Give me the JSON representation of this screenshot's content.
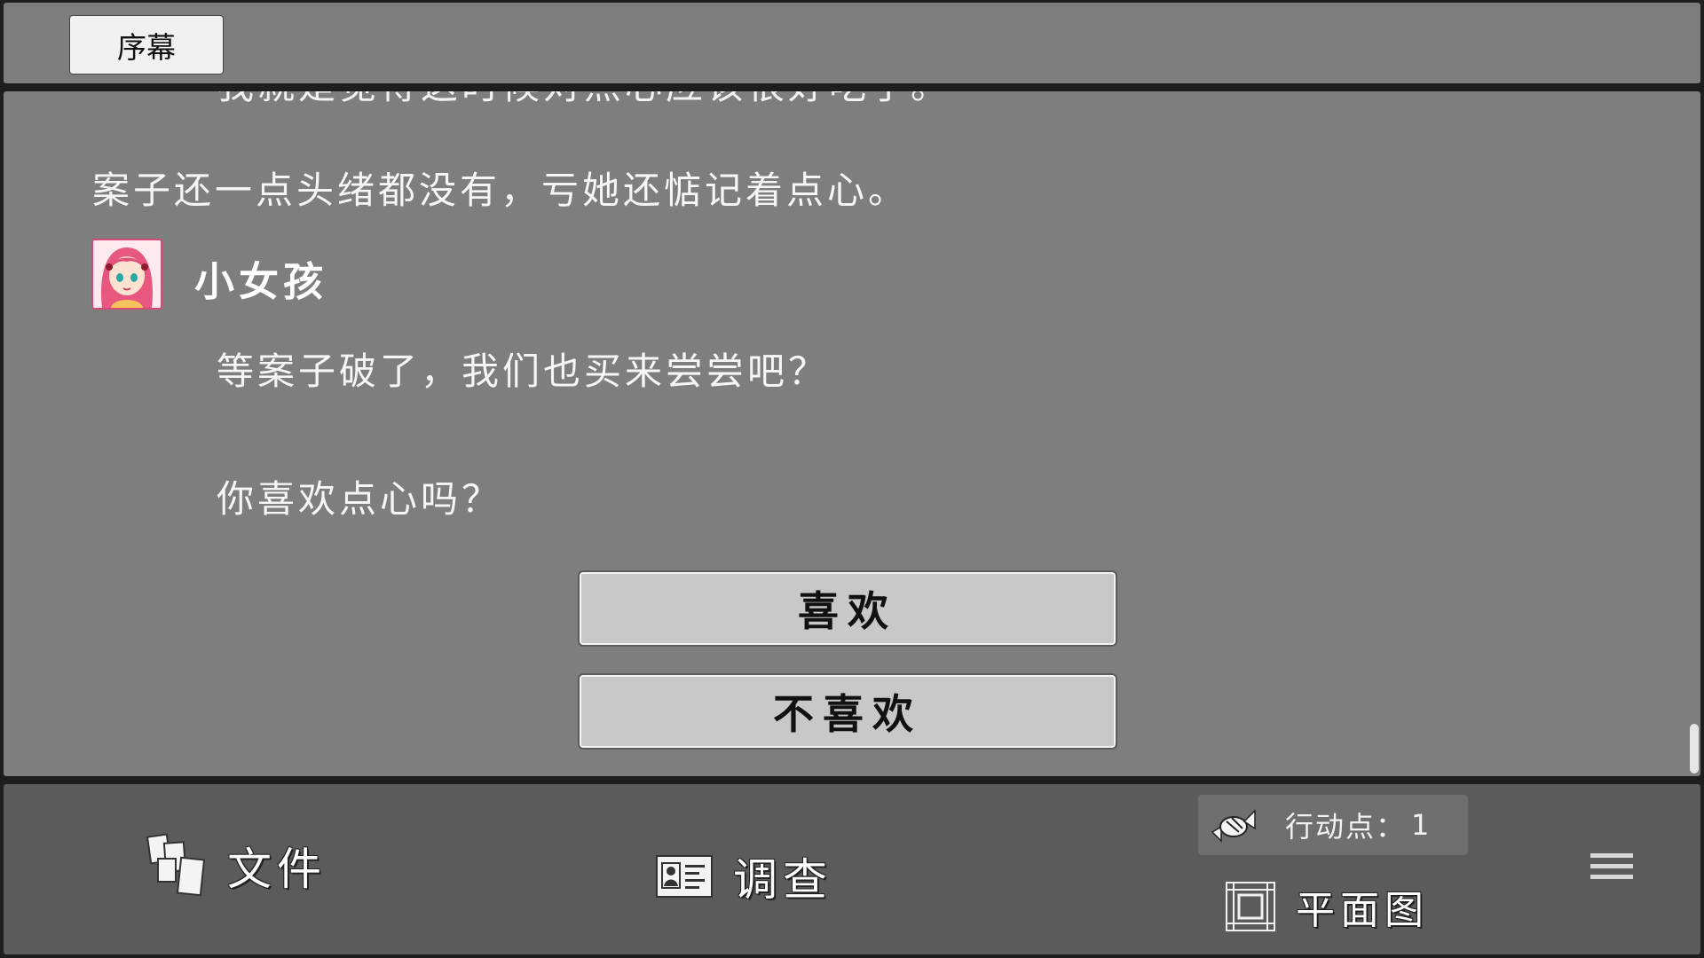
{
  "chapter": {
    "label": "序幕"
  },
  "dialogue": {
    "cut_off_line": "我就是觉得这时候对点心应该很好吃了。",
    "narration": "案子还一点头绪都没有，亏她还惦记着点心。",
    "speaker": "小女孩",
    "lines": [
      "等案子破了，我们也买来尝尝吧？",
      "你喜欢点心吗？"
    ]
  },
  "choices": [
    {
      "label": "喜欢"
    },
    {
      "label": "不喜欢"
    }
  ],
  "bottom_bar": {
    "files_label": "文件",
    "investigate_label": "调查",
    "action_points_label": "行动点：",
    "action_points_value": "1",
    "map_label": "平面图"
  },
  "icons": {
    "files": "files-icon",
    "investigate": "id-card-icon",
    "action_points": "candy-icon",
    "map": "floor-plan-icon",
    "menu": "hamburger-menu-icon"
  },
  "colors": {
    "panel": "#7e7e7e",
    "bottom_bar": "#5b5b5b",
    "choice_bg": "#c8c8c8",
    "avatar_border": "#d44c76"
  }
}
